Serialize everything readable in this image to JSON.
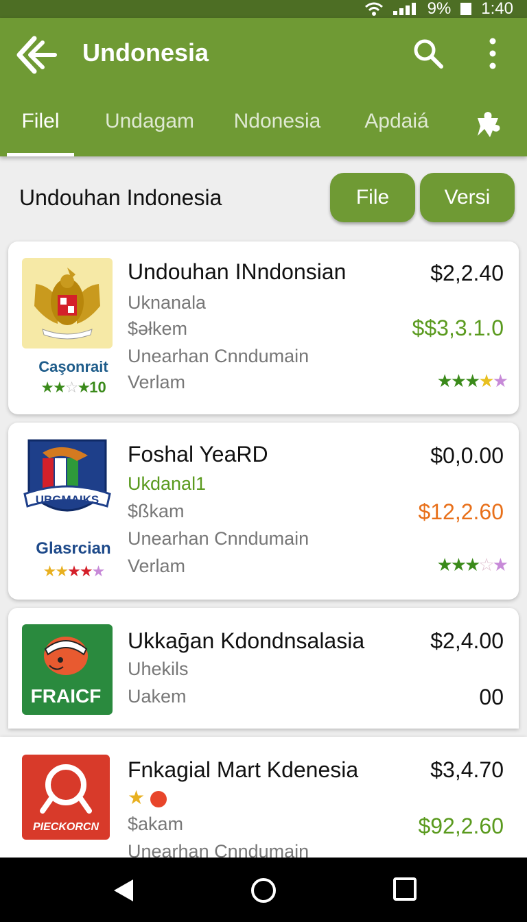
{
  "status_bar": {
    "battery": "9%",
    "time": "1:40"
  },
  "app_bar": {
    "title": "Undonesia"
  },
  "tabs": [
    {
      "label": "Filel",
      "active": true
    },
    {
      "label": "Undagam",
      "active": false
    },
    {
      "label": "Ndonesia",
      "active": false
    },
    {
      "label": "Apdaiá",
      "active": false
    }
  ],
  "filter": {
    "title": "Undouhan Indonesia",
    "file_label": "File",
    "versi_label": "Versi"
  },
  "colors": {
    "primary": "#6f9a34",
    "status_bar": "#4d6e24",
    "green_text": "#5a9a1e",
    "orange_text": "#e8701a"
  },
  "items": [
    {
      "name": "Undouhan INndonsian",
      "line1": "Uknanala",
      "line2": "$əłkem",
      "line3": "Unearhan Cnndumain",
      "line4": "Verlam",
      "price_top": "$2,2.40",
      "price_mid": "$$3,3.1.0",
      "brand": "Caşonrait",
      "thumb_rating": "10",
      "rating": 3.5
    },
    {
      "name": "Foshal YeaRD",
      "line1": "Ukdanal1",
      "line2": "$ßkam",
      "line3": "Unearhan Cnndumain",
      "line4": "Verlam",
      "price_top": "$0,0.00",
      "price_mid": "$12,2.60",
      "brand": "Glasrcian",
      "badge_text": "UBGMAIKS",
      "rating": 3
    },
    {
      "name": "Ukkaḡan Kdondnsalasia",
      "line1": "Uhekils",
      "line2": "Uakem",
      "price_top": "$2,4.00",
      "price_mid": "00",
      "badge_text": "FRAICF"
    },
    {
      "name": "Fnkagial Mart Kdenesia",
      "line2": "$akam",
      "line3": "Unearhan Cnndumain",
      "price_top": "$3,4.70",
      "price_mid": "$92,2.60",
      "badge_text": "PIECKORCN"
    }
  ]
}
